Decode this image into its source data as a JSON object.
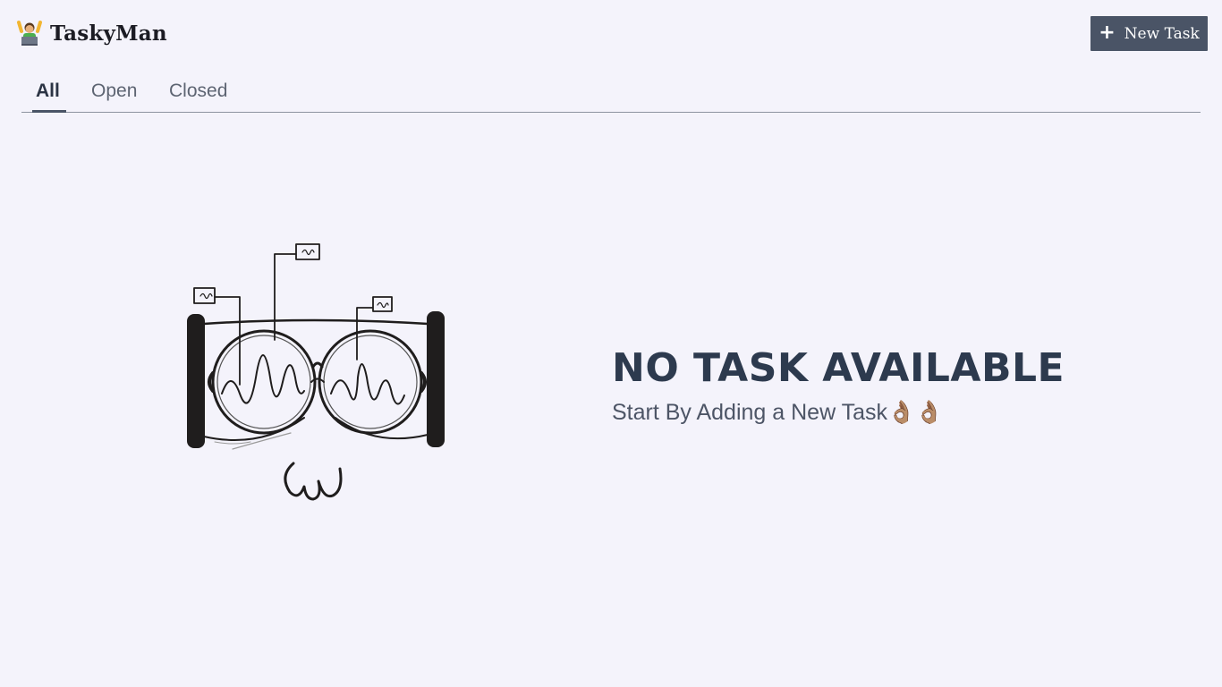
{
  "app": {
    "name": "TaskyMan",
    "logo_icon": "person-raising-hands-with-laptop-icon"
  },
  "toolbar": {
    "new_task_label": "New Task",
    "new_task_icon": "plus-icon"
  },
  "tabs": [
    {
      "label": "All",
      "active": true
    },
    {
      "label": "Open",
      "active": false
    },
    {
      "label": "Closed",
      "active": false
    }
  ],
  "empty_state": {
    "title": "NO TASK AVAILABLE",
    "subtitle": "Start By Adding a New Task👌🏽👌🏽",
    "illustration": "glasses-doodle-illustration"
  },
  "colors": {
    "background": "#f4f3fb",
    "button": "#4a5466",
    "title": "#2d3a4e"
  }
}
